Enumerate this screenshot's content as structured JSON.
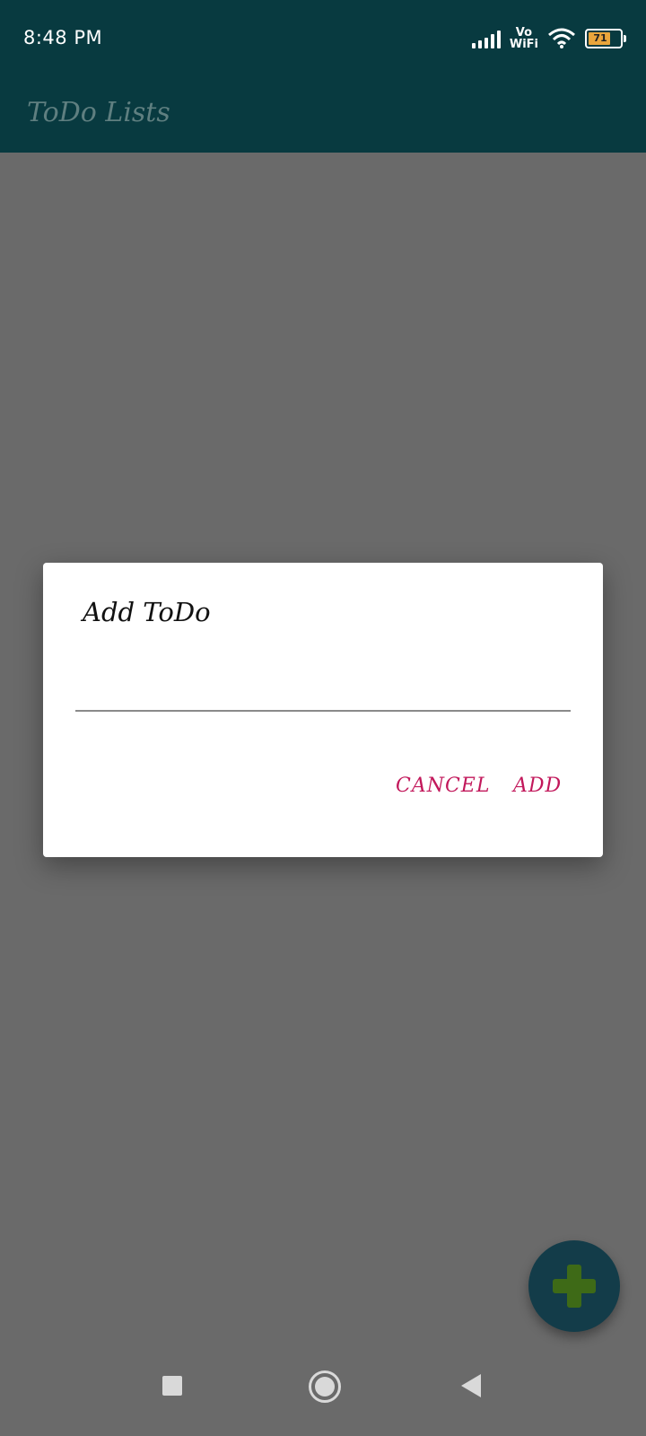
{
  "status_bar": {
    "time": "8:48 PM",
    "network_label_top": "Vo",
    "network_label_bottom": "WiFi",
    "battery_level": "71",
    "icons": [
      "signal-icon",
      "wifi-icon",
      "battery-icon"
    ]
  },
  "app_bar": {
    "title": "ToDo Lists"
  },
  "dialog": {
    "title": "Add ToDo",
    "input_value": "",
    "input_placeholder": "",
    "cancel_label": "CANCEL",
    "add_label": "ADD"
  },
  "fab": {
    "icon": "plus-icon"
  },
  "nav_bar": {
    "icons": [
      "recents-icon",
      "home-icon",
      "back-icon"
    ]
  },
  "colors": {
    "app_bar": "#083a40",
    "scrim": "#6a6a6a",
    "accent": "#c2185b",
    "fab": "#133c49",
    "fab_icon": "#3e6a17"
  }
}
